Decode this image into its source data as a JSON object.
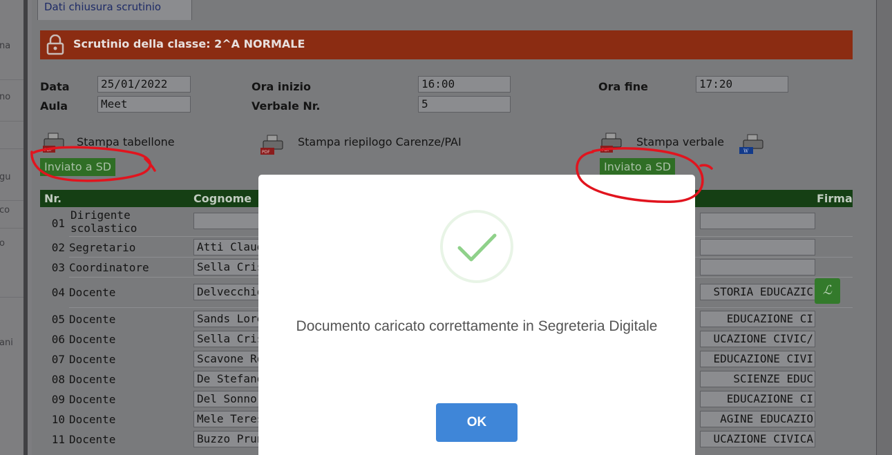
{
  "background_page": {
    "left_fragments": [
      "na",
      "no",
      "gu",
      "co",
      "o",
      "ani"
    ]
  },
  "window": {
    "tab_label": "Dati chiusura scrutinio",
    "header_title": "Scrutinio della classe: 2^A NORMALE",
    "fields": {
      "data_label": "Data",
      "data_value": "25/01/2022",
      "aula_label": "Aula",
      "aula_value": "Meet",
      "ora_inizio_label": "Ora inizio",
      "ora_inizio_value": "16:00",
      "verbale_label": "Verbale Nr.",
      "verbale_value": "5",
      "ora_fine_label": "Ora fine",
      "ora_fine_value": "17:20"
    },
    "prints": {
      "tabellone": "Stampa tabellone",
      "carenze": "Stampa riepilogo Carenze/PAI",
      "verbale": "Stampa verbale"
    },
    "sent_badge": "Inviato a SD",
    "table": {
      "headers": [
        "Nr.",
        "Cognome",
        "Firma"
      ],
      "rows": [
        {
          "num": "01",
          "role_line1": "Dirigente",
          "role_line2": "scolastico",
          "name": "",
          "subject": ""
        },
        {
          "num": "02",
          "role": "Segretario",
          "name": "Atti Claudia",
          "subject": ""
        },
        {
          "num": "03",
          "role": "Coordinatore",
          "name": "Sella Cristina",
          "subject": ""
        },
        {
          "num": "04",
          "role": "Docente",
          "name": "Delvecchio",
          "subject": "STORIA EDUCAZIC"
        },
        {
          "num": "05",
          "role": "Docente",
          "name": "Sands Lorena",
          "subject": "EDUCAZIONE CI"
        },
        {
          "num": "06",
          "role": "Docente",
          "name": "Sella Cristina",
          "subject": "UCAZIONE CIVIC/"
        },
        {
          "num": "07",
          "role": "Docente",
          "name": "Scavone Rosa",
          "subject": "EDUCAZIONE CIVI"
        },
        {
          "num": "08",
          "role": "Docente",
          "name": "De Stefano",
          "subject": "SCIENZE EDUC"
        },
        {
          "num": "09",
          "role": "Docente",
          "name": "Del Sonno",
          "subject": "EDUCAZIONE CI"
        },
        {
          "num": "10",
          "role": "Docente",
          "name": "Mele Teresa",
          "subject": "AGINE EDUCAZIO"
        },
        {
          "num": "11",
          "role": "Docente",
          "name": "Buzzo Pruner",
          "subject": "UCAZIONE CIVICA"
        }
      ]
    }
  },
  "dialog": {
    "message": "Documento caricato correttamente in Segreteria Digitale",
    "ok_label": "OK"
  },
  "colors": {
    "header_red": "#8b2c12",
    "table_head_green": "#153f14",
    "badge_green": "#2f6e25",
    "ok_blue": "#3f86d8",
    "check_green": "#8fd18a",
    "annotation_red": "#e1141e"
  }
}
